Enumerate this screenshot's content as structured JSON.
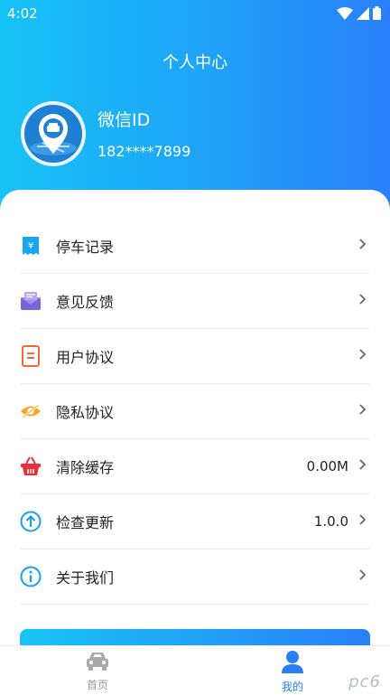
{
  "status_bar": {
    "time": "4:02"
  },
  "header": {
    "title": "个人中心"
  },
  "profile": {
    "nickname": "微信ID",
    "phone": "182****7899"
  },
  "menu": [
    {
      "label": "停车记录",
      "icon": "receipt-yen-icon",
      "value": ""
    },
    {
      "label": "意见反馈",
      "icon": "mail-feedback-icon",
      "value": ""
    },
    {
      "label": "用户协议",
      "icon": "document-icon",
      "value": ""
    },
    {
      "label": "隐私协议",
      "icon": "eye-hidden-icon",
      "value": ""
    },
    {
      "label": "清除缓存",
      "icon": "basket-icon",
      "value": "0.00M"
    },
    {
      "label": "检查更新",
      "icon": "upload-arrow-icon",
      "value": "1.0.0"
    },
    {
      "label": "关于我们",
      "icon": "info-icon",
      "value": ""
    }
  ],
  "tabbar": {
    "home_label": "首页",
    "mine_label": "我的"
  },
  "watermark": "pc6",
  "colors": {
    "accent": "#2a7ff8",
    "gradient_start": "#17c3f5"
  }
}
